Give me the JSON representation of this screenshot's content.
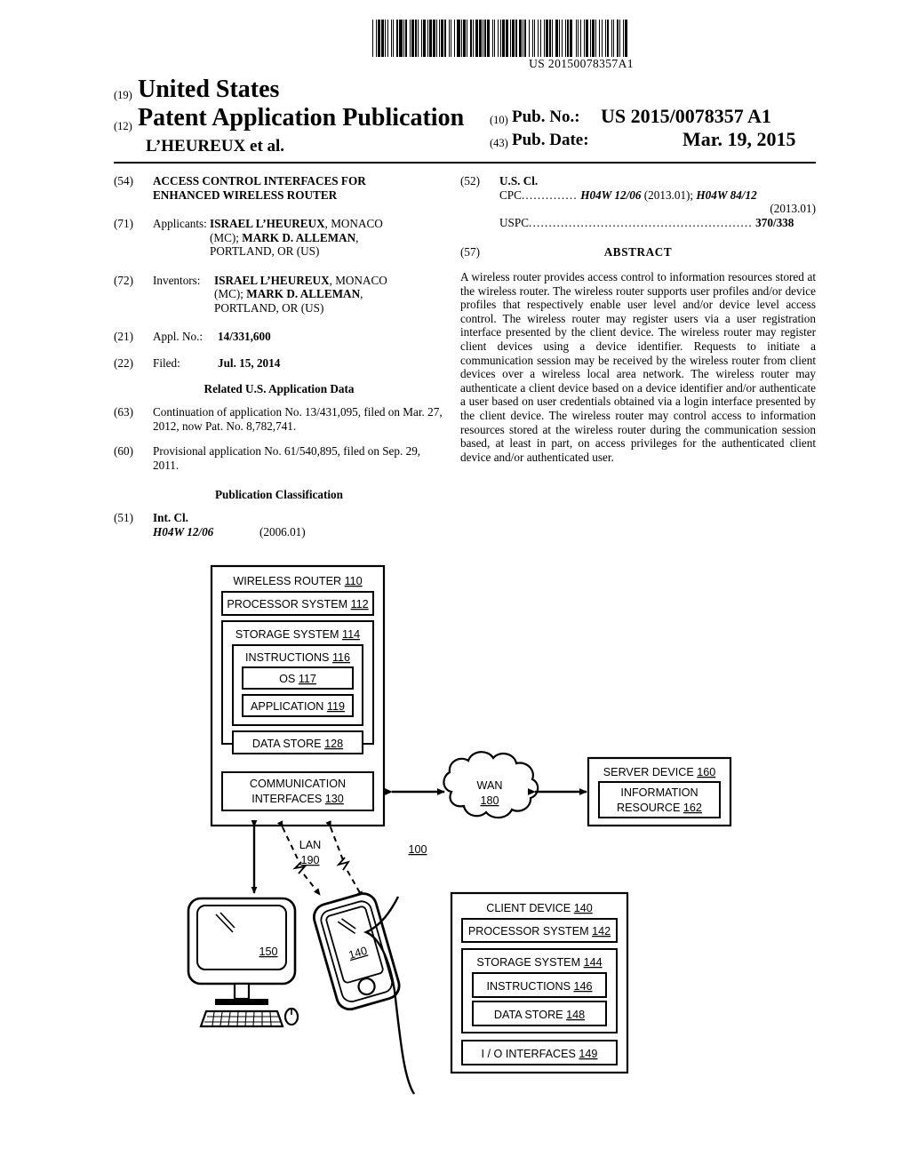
{
  "barcode": {
    "number": "US 20150078357A1"
  },
  "header": {
    "country_paren": "(19)",
    "country": "United States",
    "doc_type_paren": "(12)",
    "doc_type": "Patent Application Publication",
    "authors": "L’HEUREUX et al.",
    "pub_no_paren": "(10)",
    "pub_no_label": "Pub. No.:",
    "pub_no_value": "US 2015/0078357 A1",
    "pub_date_paren": "(43)",
    "pub_date_label": "Pub. Date:",
    "pub_date_value": "Mar. 19, 2015"
  },
  "left_column": {
    "title": {
      "num": "(54)",
      "line1": "ACCESS CONTROL INTERFACES FOR",
      "line2": "ENHANCED WIRELESS ROUTER"
    },
    "applicants": {
      "num": "(71)",
      "label": "Applicants:",
      "name1": "ISRAEL L’HEUREUX",
      "loc1": ", MONACO",
      "line2_prefix": "(MC); ",
      "name2": "MARK D. ALLEMAN",
      "line2_suffix": ",",
      "line3": "PORTLAND, OR (US)"
    },
    "inventors": {
      "num": "(72)",
      "label": "Inventors:",
      "name1": "ISRAEL L’HEUREUX",
      "loc1": ", MONACO",
      "line2_prefix": "(MC); ",
      "name2": "MARK D. ALLEMAN",
      "line2_suffix": ",",
      "line3": "PORTLAND, OR (US)"
    },
    "appl_no": {
      "num": "(21)",
      "label": "Appl. No.:",
      "value": "14/331,600"
    },
    "filed": {
      "num": "(22)",
      "label": "Filed:",
      "value": "Jul. 15, 2014"
    },
    "related_head": "Related U.S. Application Data",
    "continuation": {
      "num": "(63)",
      "text": "Continuation of application No. 13/431,095, filed on Mar. 27, 2012, now Pat. No. 8,782,741."
    },
    "provisional": {
      "num": "(60)",
      "text": "Provisional application No. 61/540,895, filed on Sep. 29, 2011."
    },
    "pub_class_head": "Publication Classification",
    "int_cl": {
      "num": "(51)",
      "label": "Int. Cl.",
      "code": "H04W 12/06",
      "version": "(2006.01)"
    }
  },
  "right_column": {
    "us_cl": {
      "num": "(52)",
      "label": "U.S. Cl.",
      "cpc_label": "CPC",
      "cpc_dots": "..............",
      "cpc_code1": "H04W 12/06",
      "cpc_ver1": "(2013.01); ",
      "cpc_code2": "H04W 84/12",
      "cpc_ver2": "(2013.01)",
      "uspc_label": "USPC",
      "uspc_dots": "........................................................",
      "uspc_value": "370/338"
    },
    "abstract": {
      "num": "(57)",
      "title": "ABSTRACT",
      "text": "A wireless router provides access control to information resources stored at the wireless router. The wireless router supports user profiles and/or device profiles that respectively enable user level and/or device level access control. The wireless router may register users via a user registration interface presented by the client device. The wireless router may register client devices using a device identifier. Requests to initiate a communication session may be received by the wireless router from client devices over a wireless local area network. The wireless router may authenticate a client device based on a device identifier and/or authenticate a user based on user credentials obtained via a login interface presented by the client device. The wireless router may control access to information resources stored at the wireless router during the communication session based, at least in part, on access privileges for the authenticated client device and/or authenticated user."
    }
  },
  "figure": {
    "system_ref": "100",
    "wireless_router": {
      "label": "WIRELESS ROUTER",
      "ref": "110"
    },
    "processor_system": {
      "label": "PROCESSOR SYSTEM",
      "ref": "112"
    },
    "storage_system": {
      "label": "STORAGE SYSTEM",
      "ref": "114"
    },
    "instructions": {
      "label": "INSTRUCTIONS",
      "ref": "116"
    },
    "os": {
      "label": "OS",
      "ref": "117"
    },
    "application": {
      "label": "APPLICATION",
      "ref": "119"
    },
    "data_store": {
      "label": "DATA STORE",
      "ref": "128"
    },
    "communication_interfaces": {
      "line1": "COMMUNICATION",
      "line2": "INTERFACES",
      "ref": "130"
    },
    "wan": {
      "label": "WAN",
      "ref": "180"
    },
    "lan": {
      "label": "LAN",
      "ref": "190"
    },
    "server_device": {
      "label": "SERVER DEVICE",
      "ref": "160"
    },
    "information_resource": {
      "line1": "INFORMATION",
      "line2": "RESOURCE",
      "ref": "162"
    },
    "computer_ref": "150",
    "phone_ref": "140",
    "client_device": {
      "label": "CLIENT DEVICE",
      "ref": "140"
    },
    "client_processor_system": {
      "label": "PROCESSOR SYSTEM",
      "ref": "142"
    },
    "client_storage_system": {
      "label": "STORAGE SYSTEM",
      "ref": "144"
    },
    "client_instructions": {
      "label": "INSTRUCTIONS",
      "ref": "146"
    },
    "client_data_store": {
      "label": "DATA STORE",
      "ref": "148"
    },
    "client_io_interfaces": {
      "label": "I / O INTERFACES",
      "ref": "149"
    }
  }
}
